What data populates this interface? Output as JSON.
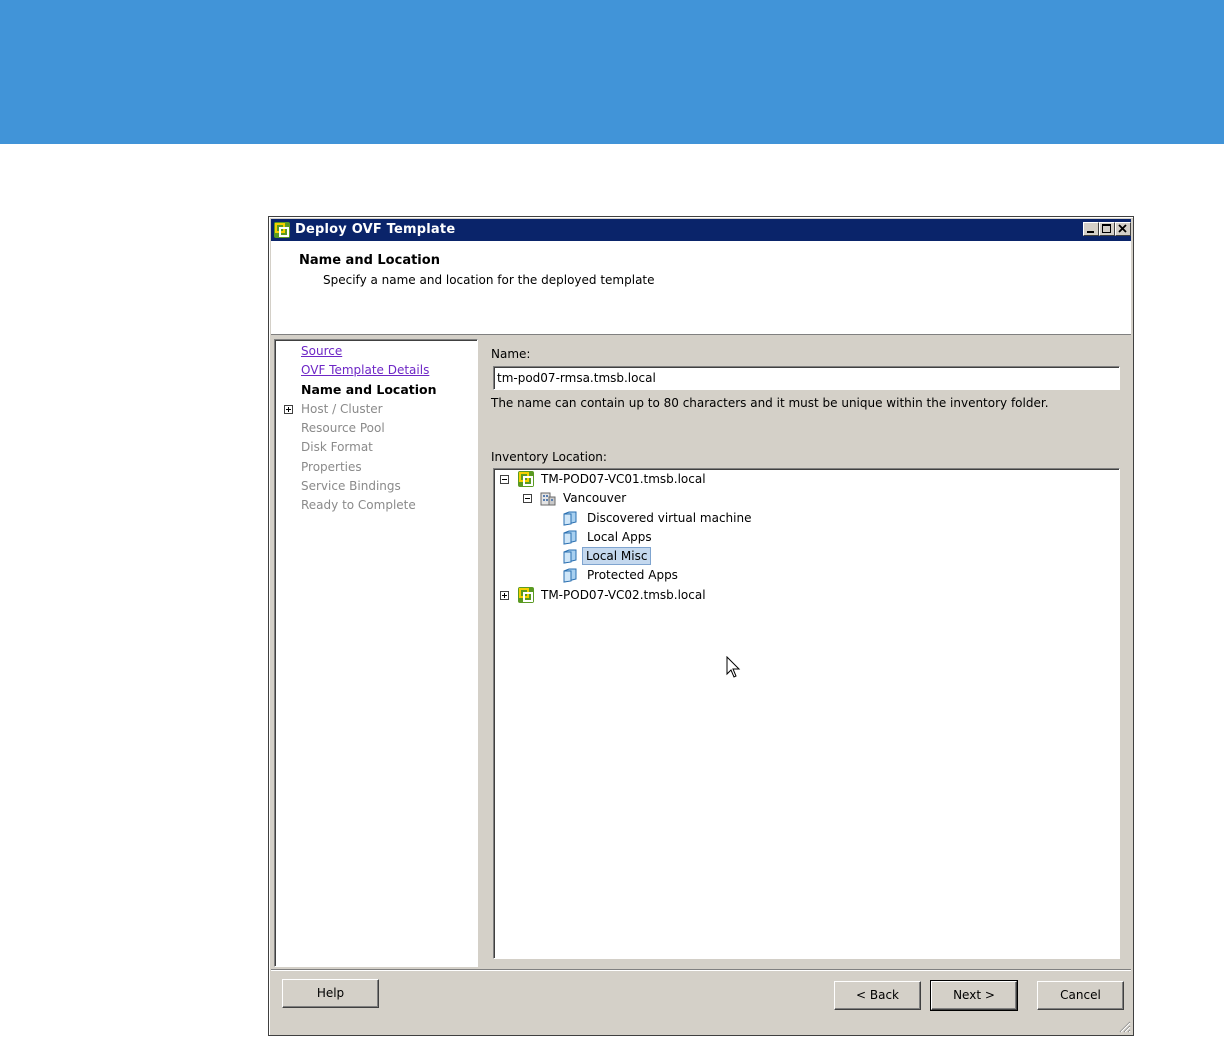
{
  "window": {
    "title": "Deploy OVF Template"
  },
  "header": {
    "title": "Name and Location",
    "subtitle": "Specify a name and location for the deployed template"
  },
  "nav": {
    "items": [
      {
        "label": "Source",
        "state": "link"
      },
      {
        "label": "OVF Template Details",
        "state": "link"
      },
      {
        "label": "Name and Location",
        "state": "current"
      },
      {
        "label": "Host / Cluster",
        "state": "disabled"
      },
      {
        "label": "Resource Pool",
        "state": "disabled"
      },
      {
        "label": "Disk Format",
        "state": "disabled"
      },
      {
        "label": "Properties",
        "state": "disabled"
      },
      {
        "label": "Service Bindings",
        "state": "disabled"
      },
      {
        "label": "Ready to Complete",
        "state": "disabled"
      }
    ]
  },
  "form": {
    "name_label": "Name:",
    "name_value": "tm-pod07-rmsa.tmsb.local",
    "name_hint": "The name can contain up to 80 characters and it must be unique within the inventory folder.",
    "inventory_label": "Inventory Location:"
  },
  "tree": {
    "vc1": "TM-POD07-VC01.tmsb.local",
    "datacenter": "Vancouver",
    "folders": [
      "Discovered virtual machine",
      "Local Apps",
      "Local Misc",
      "Protected Apps"
    ],
    "selected_folder": "Local Misc",
    "vc2": "TM-POD07-VC02.tmsb.local"
  },
  "buttons": {
    "help": "Help",
    "back": "< Back",
    "next": "Next >",
    "cancel": "Cancel"
  },
  "colors": {
    "banner": "#4194d8",
    "titlebar": "#0a246a",
    "link": "#6e27c6",
    "selection": "#c4d8ee"
  }
}
